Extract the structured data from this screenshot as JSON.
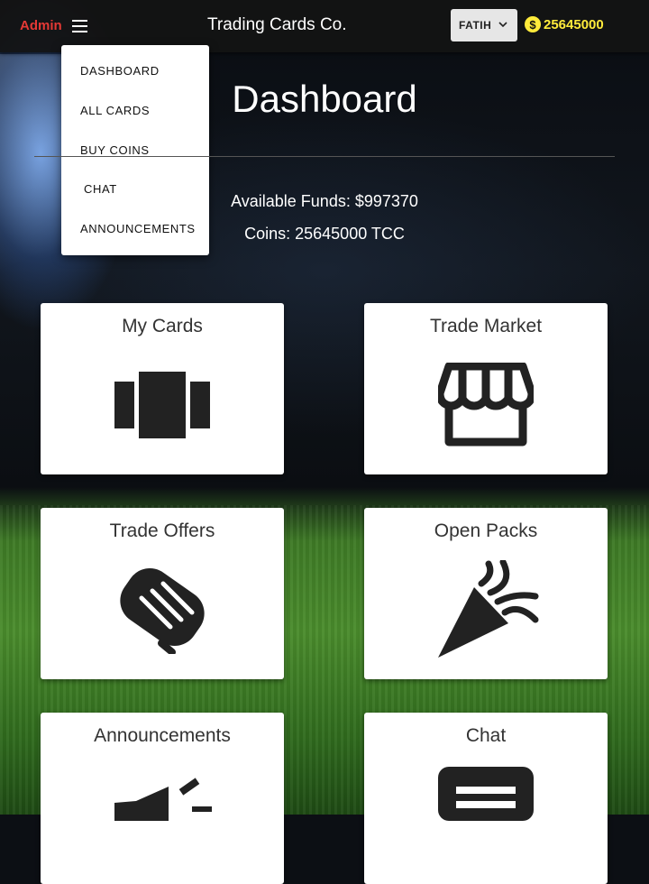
{
  "header": {
    "admin_label": "Admin",
    "brand": "Trading Cards Co.",
    "user_label": "FATIH",
    "coin_symbol": "$",
    "coins": "25645000"
  },
  "nav_menu": {
    "items": [
      {
        "label": "DASHBOARD"
      },
      {
        "label": "ALL CARDS"
      },
      {
        "label": "BUY COINS"
      },
      {
        "label": "CHAT"
      },
      {
        "label": "ANNOUNCEMENTS"
      }
    ]
  },
  "main": {
    "title": "Dashboard",
    "funds": "Available Funds: $997370",
    "coins": "Coins: 25645000 TCC"
  },
  "cards": [
    {
      "label": "My Cards",
      "icon": "cards-icon"
    },
    {
      "label": "Trade Market",
      "icon": "storefront-icon"
    },
    {
      "label": "Trade Offers",
      "icon": "handshake-icon"
    },
    {
      "label": "Open Packs",
      "icon": "party-popper-icon"
    },
    {
      "label": "Announcements",
      "icon": "megaphone-icon"
    },
    {
      "label": "Chat",
      "icon": "chat-icon"
    }
  ],
  "colors": {
    "admin": "#e53935",
    "coins": "#ffeb3b",
    "topbar": "#141414",
    "icon": "#222222"
  }
}
